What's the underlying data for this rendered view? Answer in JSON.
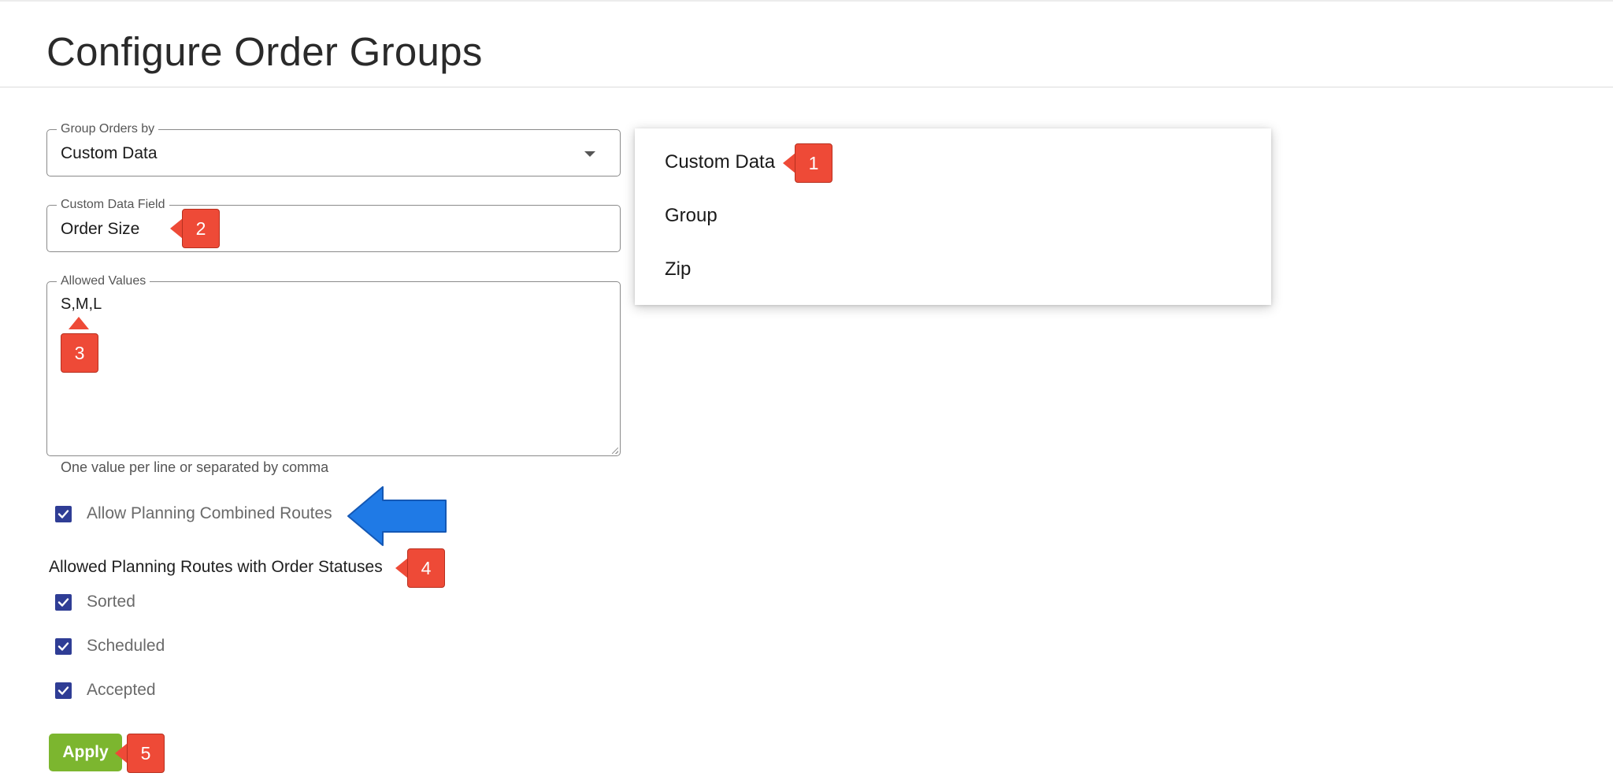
{
  "page": {
    "title": "Configure Order Groups"
  },
  "group_orders": {
    "legend": "Group Orders by",
    "value": "Custom Data"
  },
  "custom_field": {
    "legend": "Custom Data Field",
    "value": "Order Size"
  },
  "allowed_values": {
    "legend": "Allowed Values",
    "value": "S,M,L",
    "helper": "One value per line or separated by comma"
  },
  "dropdown": {
    "options": [
      {
        "label": "Custom Data"
      },
      {
        "label": "Group"
      },
      {
        "label": "Zip"
      }
    ]
  },
  "combined_routes": {
    "label": "Allow Planning Combined Routes",
    "checked": true
  },
  "statuses": {
    "title": "Allowed Planning Routes with Order Statuses",
    "items": [
      {
        "label": "Sorted",
        "checked": true
      },
      {
        "label": "Scheduled",
        "checked": true
      },
      {
        "label": "Accepted",
        "checked": true
      }
    ]
  },
  "apply_label": "Apply",
  "callouts": [
    "1",
    "2",
    "3",
    "4",
    "5"
  ],
  "colors": {
    "callout": "#ee4a37",
    "arrow": "#1f7ae6",
    "checkbox": "#2f3d95",
    "apply": "#7cb62f"
  },
  "icons": {
    "select": "chevron-down-icon",
    "check": "check-icon",
    "pointer": "arrow-left-icon"
  }
}
